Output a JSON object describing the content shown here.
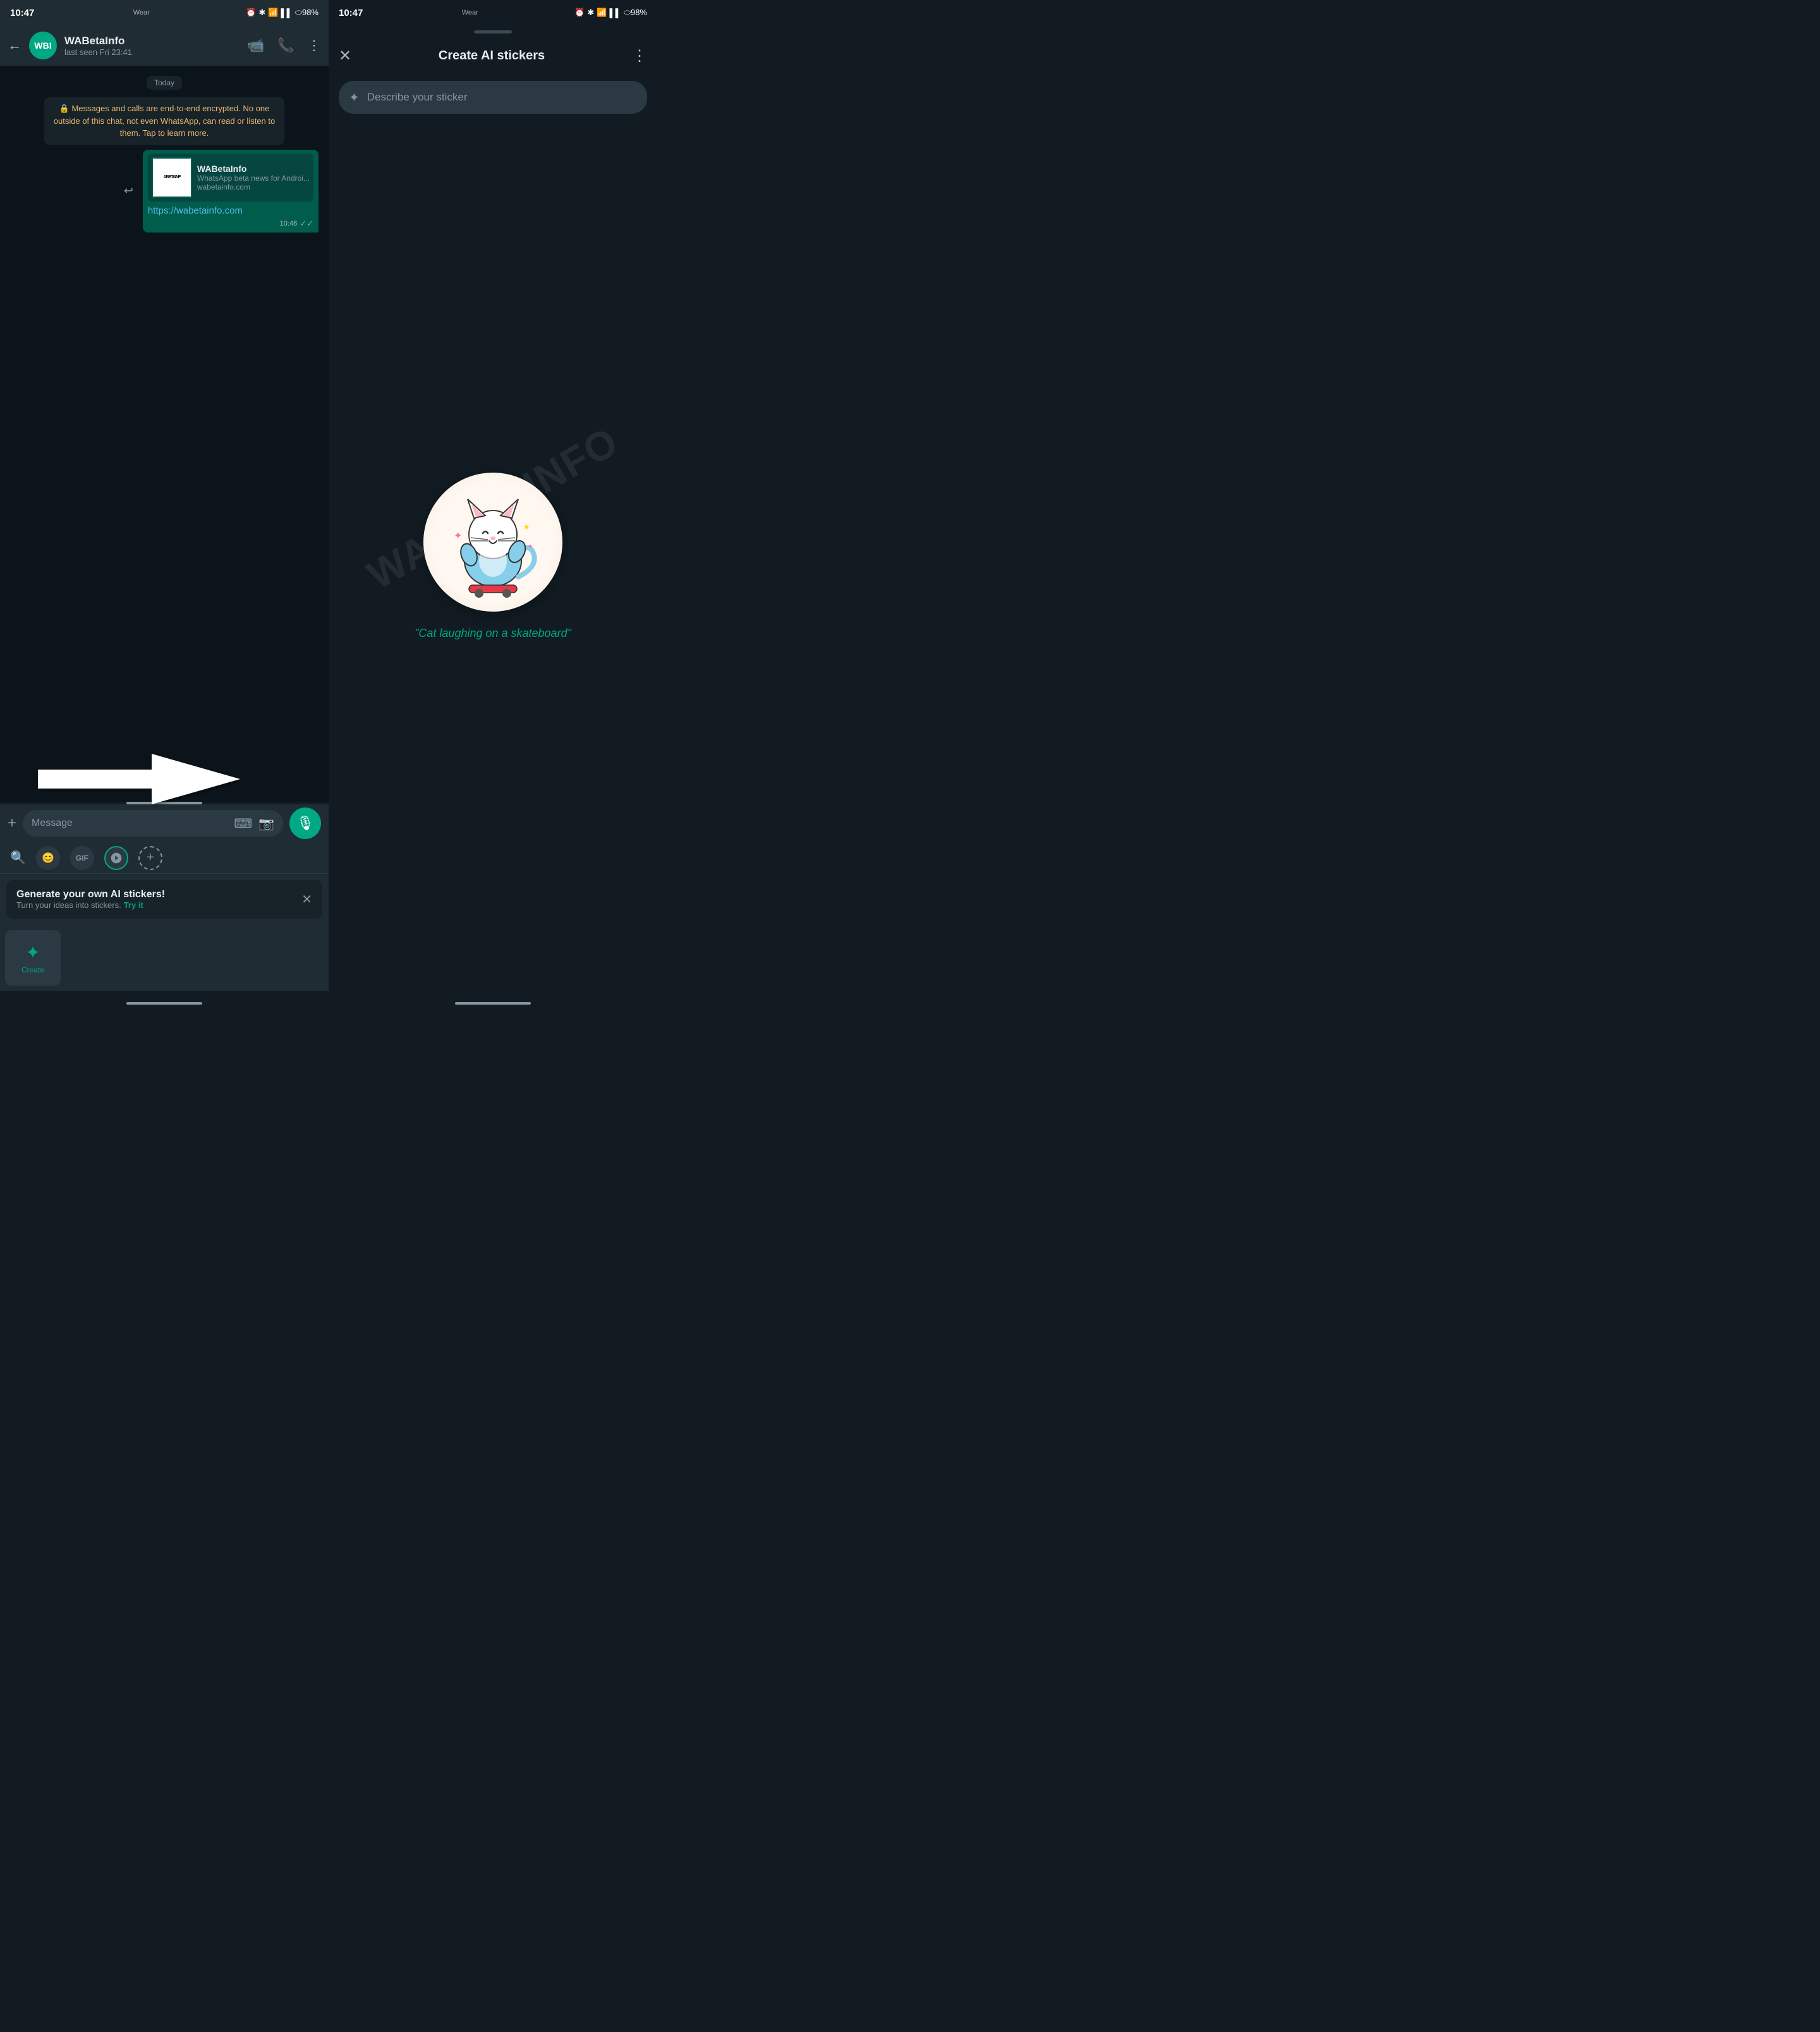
{
  "left": {
    "statusBar": {
      "time": "10:47",
      "wear": "Wear",
      "icons": "🔔 ✱ ⟨wifi⟩ ▌▌ O 98%"
    },
    "chatHeader": {
      "backLabel": "←",
      "avatarText": "WBI",
      "contactName": "WABetaInfo",
      "lastSeen": "last seen Fri 23:41",
      "videoIcon": "📹",
      "callIcon": "📞",
      "moreIcon": "⋮"
    },
    "dateBadge": "Today",
    "systemMsg": "🔒 Messages and calls are end-to-end encrypted. No one outside of this chat, not even WhatsApp, can read or listen to them. Tap to learn more.",
    "linkPreview": {
      "thumbText": "ABETAINF",
      "title": "WABetaInfo",
      "desc": "WhatsApp beta news for Androi...",
      "domain": "wabetainfo.com",
      "url": "https://wabetainfo.com",
      "time": "10:46",
      "checks": "✓✓"
    },
    "inputBar": {
      "plusIcon": "+",
      "placeholder": "Message",
      "kbdIcon": "⌨",
      "camIcon": "📷",
      "micIcon": "🎙"
    },
    "stickerPicker": {
      "searchIcon": "🔍",
      "tabs": [
        {
          "label": "😊",
          "active": false
        },
        {
          "label": "GIF",
          "active": false
        },
        {
          "label": "🗨",
          "active": true
        }
      ],
      "plusLabel": "+"
    },
    "aiPromo": {
      "title": "Generate your own AI stickers!",
      "subtitle": "Turn your ideas into stickers.",
      "tryLabel": "Try it",
      "closeIcon": "✕"
    },
    "stickerGrid": {
      "createLabel": "Create",
      "createIcon": "✦"
    },
    "arrowLabel": "←"
  },
  "right": {
    "statusBar": {
      "time": "10:47",
      "wear": "Wear",
      "icons": "🔔 ✱ ⟨wifi⟩ ▌▌ O 98%"
    },
    "header": {
      "closeIcon": "✕",
      "title": "Create AI stickers",
      "moreIcon": "⋮"
    },
    "describeInput": {
      "placeholder": "Describe your sticker",
      "sparkleIcon": "✦"
    },
    "stickerPreview": {
      "catEmoji": "🐱",
      "caption": "\"Cat laughing on a skateboard\""
    },
    "watermark": "WABETAINFO"
  }
}
